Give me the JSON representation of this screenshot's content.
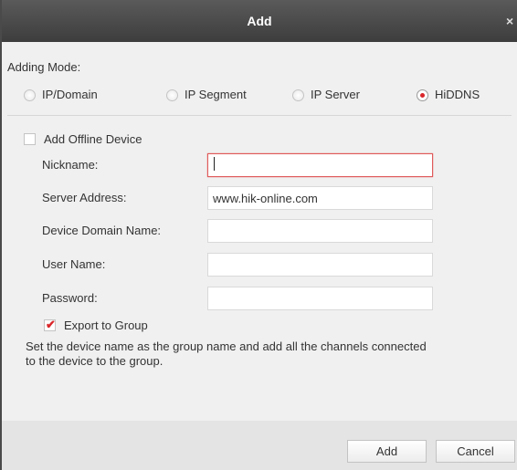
{
  "dialog": {
    "title": "Add",
    "close_label": "×"
  },
  "adding_mode": {
    "label": "Adding Mode:",
    "options": [
      {
        "label": "IP/Domain",
        "selected": false
      },
      {
        "label": "IP Segment",
        "selected": false
      },
      {
        "label": "IP Server",
        "selected": false
      },
      {
        "label": "HiDDNS",
        "selected": true
      }
    ]
  },
  "add_offline_device": {
    "label": "Add Offline Device",
    "checked": false
  },
  "fields": {
    "nickname": {
      "label": "Nickname:",
      "value": ""
    },
    "server_address": {
      "label": "Server Address:",
      "value": "www.hik-online.com"
    },
    "device_domain_name": {
      "label": "Device Domain Name:",
      "value": ""
    },
    "user_name": {
      "label": "User Name:",
      "value": ""
    },
    "password": {
      "label": "Password:",
      "value": ""
    }
  },
  "export_to_group": {
    "label": "Export to Group",
    "checked": true,
    "check_glyph": "✔",
    "description": "Set the device name as the group name and add all the channels connected to the device to the group."
  },
  "buttons": {
    "add": "Add",
    "cancel": "Cancel"
  },
  "colors": {
    "title_bar": "#3d3d3d",
    "accent_red": "#d9262a"
  }
}
